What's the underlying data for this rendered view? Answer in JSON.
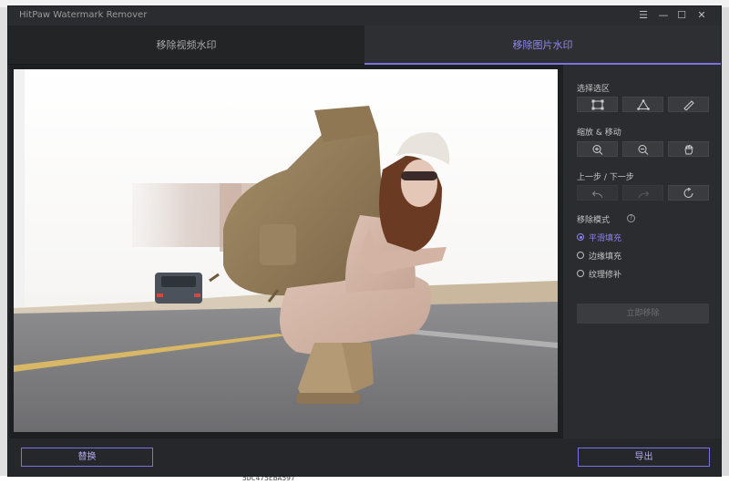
{
  "window": {
    "title": "HitPaw Watermark Remover",
    "controls": {
      "menu": "☰",
      "minimize": "—",
      "maximize": "☐",
      "close": "✕"
    }
  },
  "tabs": [
    {
      "label": "移除视频水印",
      "active": false
    },
    {
      "label": "移除图片水印",
      "active": true
    }
  ],
  "panel": {
    "selection_label": "选择选区",
    "selection_tools": [
      "rectangle-select-icon",
      "polygon-select-icon",
      "brush-icon"
    ],
    "zoom_label": "缩放 & 移动",
    "zoom_tools": [
      "zoom-in-icon",
      "zoom-out-icon",
      "hand-icon"
    ],
    "history_label": "上一步 / 下一步",
    "history_tools": [
      "undo-icon",
      "redo-icon",
      "reset-icon"
    ],
    "mode_label": "移除模式",
    "help_glyph": "?",
    "modes": [
      {
        "label": "平滑填充",
        "selected": true
      },
      {
        "label": "边缘填充",
        "selected": false
      },
      {
        "label": "纹理修补",
        "selected": false
      }
    ],
    "remove_button": "立即移除"
  },
  "footer": {
    "replace_button": "替换",
    "export_button": "导出"
  },
  "desktop": {
    "bottom_text": "5DC475EBA597"
  },
  "colors": {
    "accent": "#7a72e2",
    "accent_text": "#8e86ee",
    "window_bg": "#2b2c2f"
  }
}
